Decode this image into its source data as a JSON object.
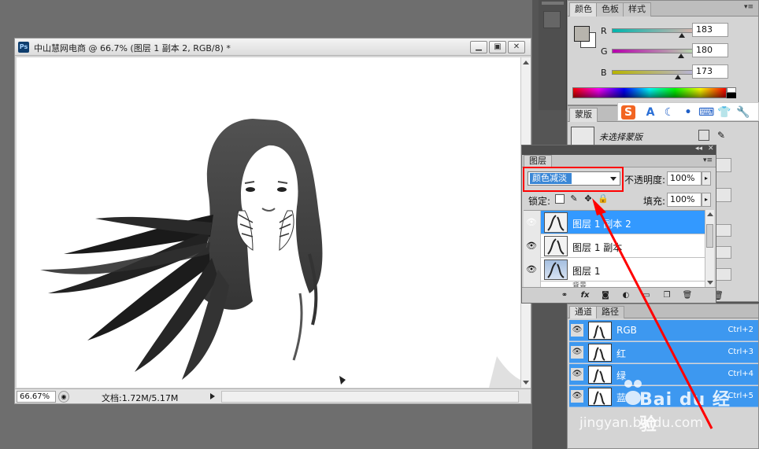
{
  "document": {
    "title": "中山慧网电商 @ 66.7% (图层 1 副本 2, RGB/8) *",
    "ps_badge": "Ps",
    "zoom": "66.67%",
    "doc_info": "文档:1.72M/5.17M",
    "buttons": {
      "minimize": "▁",
      "restore": "▣",
      "close": "✕"
    }
  },
  "color_panel": {
    "tabs": [
      "颜色",
      "色板",
      "样式"
    ],
    "channels": [
      {
        "label": "R",
        "value": "183",
        "fraction": 0.717
      },
      {
        "label": "G",
        "value": "180",
        "fraction": 0.706
      },
      {
        "label": "B",
        "value": "173",
        "fraction": 0.678
      }
    ],
    "fg_color": "#b7b4ad"
  },
  "mask_panel": {
    "tab": "蒙版",
    "status": "未选择蒙版"
  },
  "layers_panel": {
    "tab": "图层",
    "blend_mode": "颜色减淡",
    "opacity_label": "不透明度:",
    "opacity_value": "100%",
    "lock_label": "锁定:",
    "fill_label": "填充:",
    "fill_value": "100%",
    "layers": [
      {
        "name": "图层 1 副本 2",
        "selected": true
      },
      {
        "name": "图层 1 副本",
        "selected": false
      },
      {
        "name": "图层 1",
        "selected": false
      }
    ],
    "partial_layer": "背景"
  },
  "channels_panel": {
    "tabs": [
      "通道",
      "路径"
    ],
    "channels": [
      {
        "name": "RGB",
        "shortcut": "Ctrl+2"
      },
      {
        "name": "红",
        "shortcut": "Ctrl+3"
      },
      {
        "name": "绿",
        "shortcut": "Ctrl+4"
      },
      {
        "name": "蓝",
        "shortcut": "Ctrl+5"
      }
    ]
  },
  "ime_toolbar": {
    "logo": "S",
    "items": [
      "A",
      "☾",
      "•",
      "⌨",
      "👕",
      "🔧"
    ]
  },
  "watermark": {
    "brand": "Bai du 经验",
    "url": "jingyan.baidu.com"
  },
  "colors": {
    "selection_blue": "#3399ff",
    "annotation_red": "#ff0000",
    "panel_bg": "#d4d4d4",
    "workspace_bg": "#6e6e6e"
  }
}
